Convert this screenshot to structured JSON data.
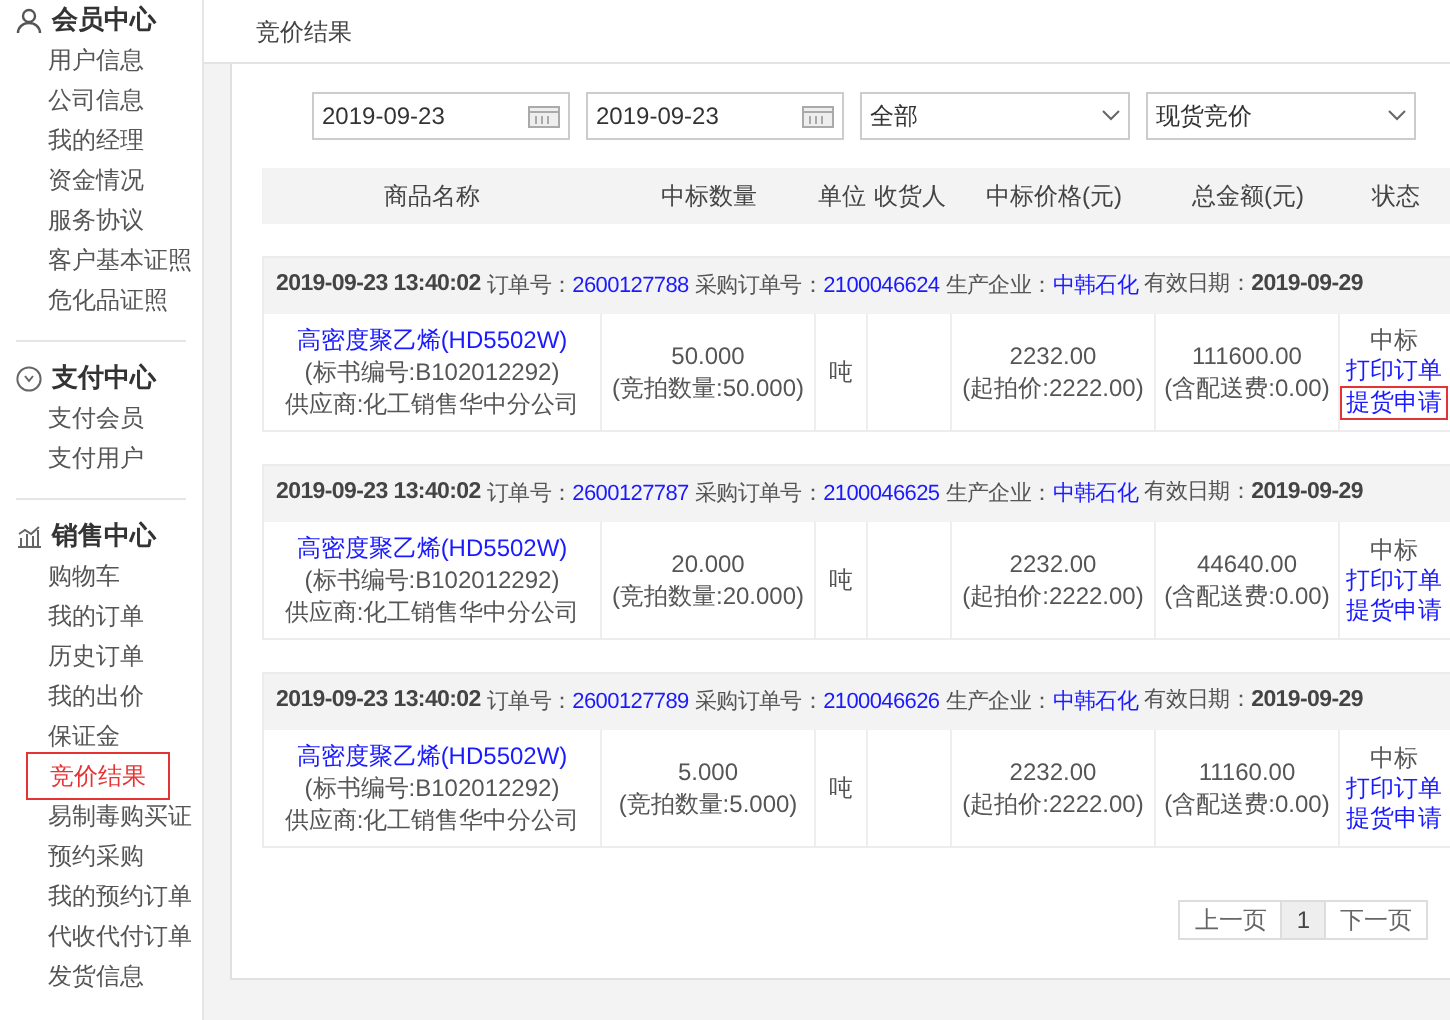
{
  "sidebar": {
    "groups": [
      {
        "title": "会员中心",
        "items": [
          {
            "label": "用户信息",
            "selected": false
          },
          {
            "label": "公司信息",
            "selected": false
          },
          {
            "label": "我的经理",
            "selected": false
          },
          {
            "label": "资金情况",
            "selected": false
          },
          {
            "label": "服务协议",
            "selected": false
          },
          {
            "label": "客户基本证照",
            "selected": false
          },
          {
            "label": "危化品证照",
            "selected": false
          }
        ]
      },
      {
        "title": "支付中心",
        "items": [
          {
            "label": "支付会员",
            "selected": false
          },
          {
            "label": "支付用户",
            "selected": false
          }
        ]
      },
      {
        "title": "销售中心",
        "items": [
          {
            "label": "购物车",
            "selected": false
          },
          {
            "label": "我的订单",
            "selected": false
          },
          {
            "label": "历史订单",
            "selected": false
          },
          {
            "label": "我的出价",
            "selected": false
          },
          {
            "label": "保证金",
            "selected": false
          },
          {
            "label": "竞价结果",
            "selected": true
          },
          {
            "label": "易制毒购买证",
            "selected": false
          },
          {
            "label": "预约采购",
            "selected": false
          },
          {
            "label": "我的预约订单",
            "selected": false
          },
          {
            "label": "代收代付订单",
            "selected": false
          },
          {
            "label": "发货信息",
            "selected": false
          }
        ]
      }
    ]
  },
  "page_title": "竞价结果",
  "filters": [
    {
      "kind": "date",
      "value": "2019-09-23"
    },
    {
      "kind": "date",
      "value": "2019-09-23"
    },
    {
      "kind": "select",
      "value": "全部"
    },
    {
      "kind": "select",
      "value": "现货竞价"
    }
  ],
  "table": {
    "columns": [
      "商品名称",
      "中标数量",
      "单位",
      "收货人",
      "中标价格(元)",
      "总金额(元)",
      "状态"
    ],
    "orders": [
      {
        "time": "2019-09-23 13:40:02",
        "order_no_label": "订单号：",
        "order_no": "2600127788",
        "purchase_no_label": "采购订单号：",
        "purchase_no": "2100046624",
        "producer_label": "生产企业：",
        "producer": "中韩石化",
        "valid_label": "有效日期：",
        "valid_date": "2019-09-29",
        "product": "高密度聚乙烯(HD5502W)",
        "tender_no": "(标书编号:B102012292)",
        "supplier": "供应商:化工销售华中分公司",
        "quantity": "50.000",
        "bid_quantity": "(竞拍数量:50.000)",
        "unit": "吨",
        "price": "2232.00",
        "start_price": "(起拍价:2222.00)",
        "total": "111600.00",
        "delivery_fee": "(含配送费:0.00)",
        "status": "中标",
        "actions": [
          {
            "label": "打印订单",
            "outlined": false
          },
          {
            "label": "提货申请",
            "outlined": true
          }
        ]
      },
      {
        "time": "2019-09-23 13:40:02",
        "order_no_label": "订单号：",
        "order_no": "2600127787",
        "purchase_no_label": "采购订单号：",
        "purchase_no": "2100046625",
        "producer_label": "生产企业：",
        "producer": "中韩石化",
        "valid_label": "有效日期：",
        "valid_date": "2019-09-29",
        "product": "高密度聚乙烯(HD5502W)",
        "tender_no": "(标书编号:B102012292)",
        "supplier": "供应商:化工销售华中分公司",
        "quantity": "20.000",
        "bid_quantity": "(竞拍数量:20.000)",
        "unit": "吨",
        "price": "2232.00",
        "start_price": "(起拍价:2222.00)",
        "total": "44640.00",
        "delivery_fee": "(含配送费:0.00)",
        "status": "中标",
        "actions": [
          {
            "label": "打印订单",
            "outlined": false
          },
          {
            "label": "提货申请",
            "outlined": false
          }
        ]
      },
      {
        "time": "2019-09-23 13:40:02",
        "order_no_label": "订单号：",
        "order_no": "2600127789",
        "purchase_no_label": "采购订单号：",
        "purchase_no": "2100046626",
        "producer_label": "生产企业：",
        "producer": "中韩石化",
        "valid_label": "有效日期：",
        "valid_date": "2019-09-29",
        "product": "高密度聚乙烯(HD5502W)",
        "tender_no": "(标书编号:B102012292)",
        "supplier": "供应商:化工销售华中分公司",
        "quantity": "5.000",
        "bid_quantity": "(竞拍数量:5.000)",
        "unit": "吨",
        "price": "2232.00",
        "start_price": "(起拍价:2222.00)",
        "total": "11160.00",
        "delivery_fee": "(含配送费:0.00)",
        "status": "中标",
        "actions": [
          {
            "label": "打印订单",
            "outlined": false
          },
          {
            "label": "提货申请",
            "outlined": false
          }
        ]
      }
    ]
  },
  "pagination": {
    "prev": "上一页",
    "pages": [
      {
        "label": "1",
        "selected": true
      }
    ],
    "next": "下一页"
  }
}
